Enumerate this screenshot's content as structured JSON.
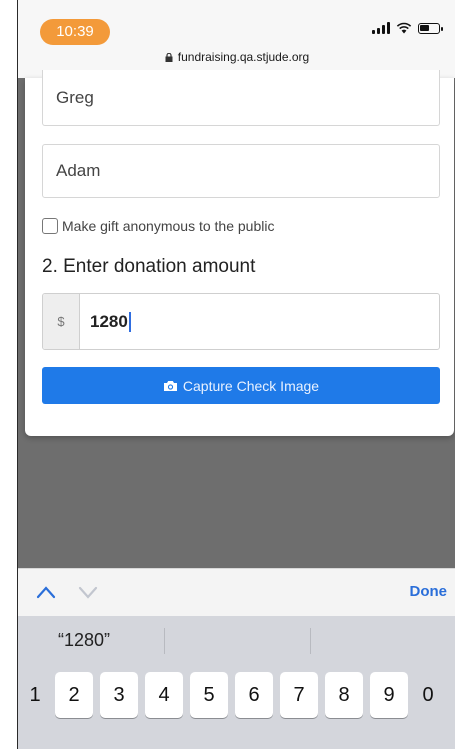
{
  "status_bar": {
    "time": "10:39",
    "url": "fundraising.qa.stjude.org",
    "icons": [
      "signal-icon",
      "wifi-icon",
      "battery-icon"
    ]
  },
  "form": {
    "first_name_value": "Greg",
    "last_name_value": "Adam",
    "anonymous_label": "Make gift anonymous to the public",
    "anonymous_checked": false,
    "amount_heading": "2. Enter donation amount",
    "currency_symbol": "$",
    "amount_value": "1280",
    "capture_button_label": "Capture Check Image",
    "capture_button_color": "#1f7ae8"
  },
  "keyboard": {
    "done_label": "Done",
    "suggestion": "“1280”",
    "digit_keys": [
      "1",
      "2",
      "3",
      "4",
      "5",
      "6",
      "7",
      "8",
      "9",
      "0"
    ]
  }
}
